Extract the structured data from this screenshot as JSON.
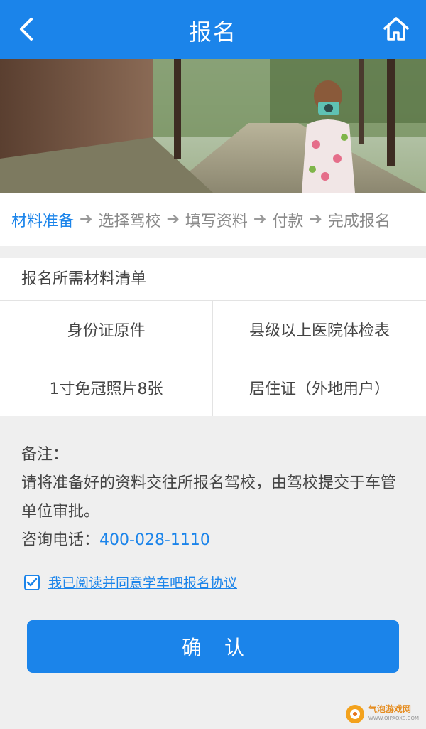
{
  "header": {
    "title": "报名",
    "back_icon": "back-arrow-icon",
    "home_icon": "home-icon",
    "bg_color": "#1b84ea"
  },
  "steps": [
    {
      "label": "材料准备",
      "active": true
    },
    {
      "label": "选择驾校",
      "active": false
    },
    {
      "label": "填写资料",
      "active": false
    },
    {
      "label": "付款",
      "active": false
    },
    {
      "label": "完成报名",
      "active": false
    }
  ],
  "materials": {
    "title": "报名所需材料清单",
    "items": [
      "身份证原件",
      "县级以上医院体检表",
      "1寸免冠照片8张",
      "居住证（外地用户）"
    ]
  },
  "notes": {
    "label": "备注：",
    "text": "请将准备好的资料交往所报名驾校，由驾校提交于车管单位审批。",
    "phone_label": "咨询电话：",
    "phone": "400-028-1110"
  },
  "agreement": {
    "checked": true,
    "label": "我已阅读并同意学车吧报名协议"
  },
  "confirm_button": "确认",
  "watermark": {
    "name": "气泡游戏网",
    "url": "WWW.QIPAOXS.COM"
  },
  "accent_color": "#1b84ea"
}
